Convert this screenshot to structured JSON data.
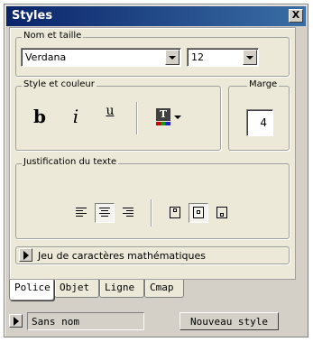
{
  "window": {
    "title": "Styles",
    "close_label": "X"
  },
  "font_group": {
    "legend": "Nom et taille",
    "font_name": "Verdana",
    "font_size": "12"
  },
  "style_group": {
    "legend": "Style et couleur",
    "bold_label": "b",
    "italic_label": "i",
    "underline_label": "u",
    "color_label": "T",
    "colors": {
      "red": "#d00000",
      "green": "#00a000",
      "blue": "#2020d0"
    }
  },
  "margin_group": {
    "legend": "Marge",
    "value": "4"
  },
  "justify_group": {
    "legend": "Justification du texte",
    "buttons": [
      "align-left-icon",
      "align-center-icon",
      "align-right-icon",
      "valign-top-icon",
      "valign-middle-icon",
      "valign-bottom-icon"
    ],
    "pressed": [
      "align-center-icon",
      "valign-middle-icon"
    ]
  },
  "math": {
    "label": "Jeu de caractères mathématiques"
  },
  "tabs": [
    {
      "label": "Police",
      "active": true
    },
    {
      "label": "Objet",
      "active": false
    },
    {
      "label": "Ligne",
      "active": false
    },
    {
      "label": "Cmap",
      "active": false
    }
  ],
  "style_row": {
    "style_name": "Sans nom",
    "new_style_label": "Nouveau style"
  }
}
